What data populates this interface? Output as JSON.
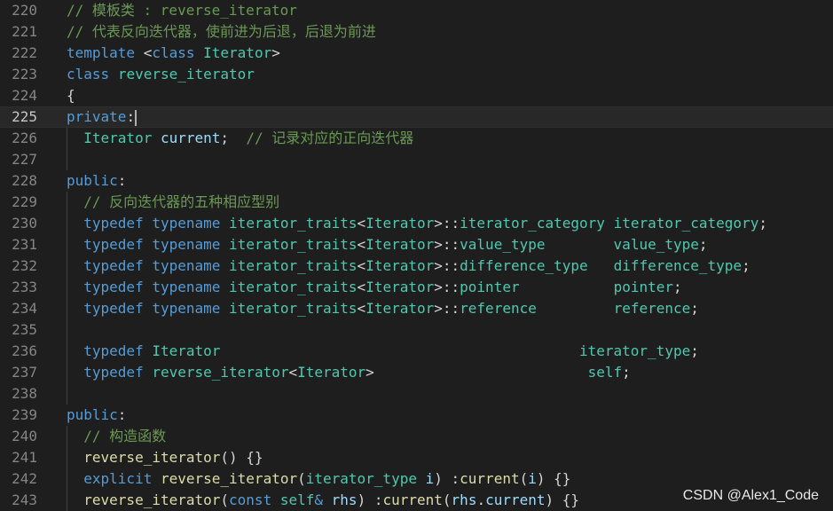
{
  "editor": {
    "watermark": "CSDN @Alex1_Code",
    "colors": {
      "background": "#1e1e1e",
      "comment": "#6a9955",
      "keyword": "#569cd6",
      "type": "#4ec9b0",
      "variable": "#9cdcfe",
      "function": "#dcdcaa",
      "plain": "#d4d4d4",
      "line_number": "#858585"
    },
    "current_line": "225",
    "lines": [
      {
        "num": "220",
        "tokens": [
          [
            "comment",
            "// 模板类 : reverse_iterator"
          ]
        ]
      },
      {
        "num": "221",
        "tokens": [
          [
            "comment",
            "// 代表反向迭代器，使前进为后退，后退为前进"
          ]
        ]
      },
      {
        "num": "222",
        "tokens": [
          [
            "keyword",
            "template"
          ],
          [
            "plain",
            " <"
          ],
          [
            "keyword",
            "class"
          ],
          [
            "plain",
            " "
          ],
          [
            "type",
            "Iterator"
          ],
          [
            "plain",
            ">"
          ]
        ]
      },
      {
        "num": "223",
        "tokens": [
          [
            "keyword",
            "class"
          ],
          [
            "plain",
            " "
          ],
          [
            "type",
            "reverse_iterator"
          ]
        ]
      },
      {
        "num": "224",
        "tokens": [
          [
            "plain",
            "{"
          ]
        ]
      },
      {
        "num": "225",
        "tokens": [
          [
            "keyword",
            "private"
          ],
          [
            "plain",
            ":"
          ]
        ]
      },
      {
        "num": "226",
        "tokens": [
          [
            "plain",
            "  "
          ],
          [
            "type",
            "Iterator"
          ],
          [
            "plain",
            " "
          ],
          [
            "var",
            "current"
          ],
          [
            "plain",
            ";  "
          ],
          [
            "comment",
            "// 记录对应的正向迭代器"
          ]
        ]
      },
      {
        "num": "227",
        "tokens": []
      },
      {
        "num": "228",
        "tokens": [
          [
            "keyword",
            "public"
          ],
          [
            "plain",
            ":"
          ]
        ]
      },
      {
        "num": "229",
        "tokens": [
          [
            "plain",
            "  "
          ],
          [
            "comment",
            "// 反向迭代器的五种相应型别"
          ]
        ]
      },
      {
        "num": "230",
        "tokens": [
          [
            "plain",
            "  "
          ],
          [
            "keyword",
            "typedef"
          ],
          [
            "plain",
            " "
          ],
          [
            "keyword",
            "typename"
          ],
          [
            "plain",
            " "
          ],
          [
            "type",
            "iterator_traits"
          ],
          [
            "plain",
            "<"
          ],
          [
            "type",
            "Iterator"
          ],
          [
            "plain",
            ">::"
          ],
          [
            "type",
            "iterator_category"
          ],
          [
            "plain",
            " "
          ],
          [
            "type",
            "iterator_category"
          ],
          [
            "plain",
            ";"
          ]
        ]
      },
      {
        "num": "231",
        "tokens": [
          [
            "plain",
            "  "
          ],
          [
            "keyword",
            "typedef"
          ],
          [
            "plain",
            " "
          ],
          [
            "keyword",
            "typename"
          ],
          [
            "plain",
            " "
          ],
          [
            "type",
            "iterator_traits"
          ],
          [
            "plain",
            "<"
          ],
          [
            "type",
            "Iterator"
          ],
          [
            "plain",
            ">::"
          ],
          [
            "type",
            "value_type"
          ],
          [
            "plain",
            "        "
          ],
          [
            "type",
            "value_type"
          ],
          [
            "plain",
            ";"
          ]
        ]
      },
      {
        "num": "232",
        "tokens": [
          [
            "plain",
            "  "
          ],
          [
            "keyword",
            "typedef"
          ],
          [
            "plain",
            " "
          ],
          [
            "keyword",
            "typename"
          ],
          [
            "plain",
            " "
          ],
          [
            "type",
            "iterator_traits"
          ],
          [
            "plain",
            "<"
          ],
          [
            "type",
            "Iterator"
          ],
          [
            "plain",
            ">::"
          ],
          [
            "type",
            "difference_type"
          ],
          [
            "plain",
            "   "
          ],
          [
            "type",
            "difference_type"
          ],
          [
            "plain",
            ";"
          ]
        ]
      },
      {
        "num": "233",
        "tokens": [
          [
            "plain",
            "  "
          ],
          [
            "keyword",
            "typedef"
          ],
          [
            "plain",
            " "
          ],
          [
            "keyword",
            "typename"
          ],
          [
            "plain",
            " "
          ],
          [
            "type",
            "iterator_traits"
          ],
          [
            "plain",
            "<"
          ],
          [
            "type",
            "Iterator"
          ],
          [
            "plain",
            ">::"
          ],
          [
            "type",
            "pointer"
          ],
          [
            "plain",
            "           "
          ],
          [
            "type",
            "pointer"
          ],
          [
            "plain",
            ";"
          ]
        ]
      },
      {
        "num": "234",
        "tokens": [
          [
            "plain",
            "  "
          ],
          [
            "keyword",
            "typedef"
          ],
          [
            "plain",
            " "
          ],
          [
            "keyword",
            "typename"
          ],
          [
            "plain",
            " "
          ],
          [
            "type",
            "iterator_traits"
          ],
          [
            "plain",
            "<"
          ],
          [
            "type",
            "Iterator"
          ],
          [
            "plain",
            ">::"
          ],
          [
            "type",
            "reference"
          ],
          [
            "plain",
            "         "
          ],
          [
            "type",
            "reference"
          ],
          [
            "plain",
            ";"
          ]
        ]
      },
      {
        "num": "235",
        "tokens": []
      },
      {
        "num": "236",
        "tokens": [
          [
            "plain",
            "  "
          ],
          [
            "keyword",
            "typedef"
          ],
          [
            "plain",
            " "
          ],
          [
            "type",
            "Iterator"
          ],
          [
            "plain",
            "                                          "
          ],
          [
            "type",
            "iterator_type"
          ],
          [
            "plain",
            ";"
          ]
        ]
      },
      {
        "num": "237",
        "tokens": [
          [
            "plain",
            "  "
          ],
          [
            "keyword",
            "typedef"
          ],
          [
            "plain",
            " "
          ],
          [
            "type",
            "reverse_iterator"
          ],
          [
            "plain",
            "<"
          ],
          [
            "type",
            "Iterator"
          ],
          [
            "plain",
            ">                         "
          ],
          [
            "type",
            "self"
          ],
          [
            "plain",
            ";"
          ]
        ]
      },
      {
        "num": "238",
        "tokens": []
      },
      {
        "num": "239",
        "tokens": [
          [
            "keyword",
            "public"
          ],
          [
            "plain",
            ":"
          ]
        ]
      },
      {
        "num": "240",
        "tokens": [
          [
            "plain",
            "  "
          ],
          [
            "comment",
            "// 构造函数"
          ]
        ]
      },
      {
        "num": "241",
        "tokens": [
          [
            "plain",
            "  "
          ],
          [
            "func",
            "reverse_iterator"
          ],
          [
            "plain",
            "() {}"
          ]
        ]
      },
      {
        "num": "242",
        "tokens": [
          [
            "plain",
            "  "
          ],
          [
            "keyword",
            "explicit"
          ],
          [
            "plain",
            " "
          ],
          [
            "func",
            "reverse_iterator"
          ],
          [
            "plain",
            "("
          ],
          [
            "type",
            "iterator_type"
          ],
          [
            "plain",
            " "
          ],
          [
            "var",
            "i"
          ],
          [
            "plain",
            ") :"
          ],
          [
            "func",
            "current"
          ],
          [
            "plain",
            "("
          ],
          [
            "var",
            "i"
          ],
          [
            "plain",
            ") {}"
          ]
        ]
      },
      {
        "num": "243",
        "tokens": [
          [
            "plain",
            "  "
          ],
          [
            "func",
            "reverse_iterator"
          ],
          [
            "plain",
            "("
          ],
          [
            "keyword",
            "const"
          ],
          [
            "plain",
            " "
          ],
          [
            "type",
            "self"
          ],
          [
            "keyword",
            "&"
          ],
          [
            "plain",
            " "
          ],
          [
            "var",
            "rhs"
          ],
          [
            "plain",
            ") :"
          ],
          [
            "func",
            "current"
          ],
          [
            "plain",
            "("
          ],
          [
            "var",
            "rhs"
          ],
          [
            "plain",
            "."
          ],
          [
            "var",
            "current"
          ],
          [
            "plain",
            ") {}"
          ]
        ]
      }
    ]
  }
}
